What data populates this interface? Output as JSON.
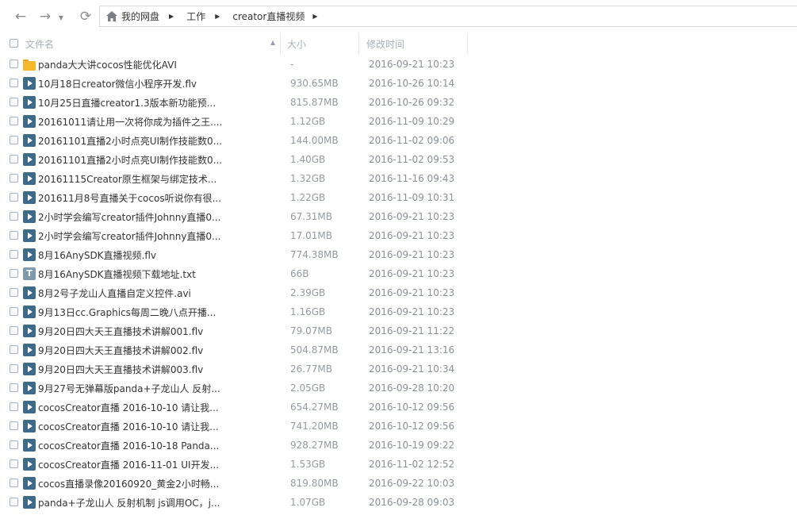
{
  "nav": {
    "back_glyph": "←",
    "forward_glyph": "→",
    "menu_glyph": "▼",
    "refresh_glyph": "⟳",
    "breadcrumbs": [
      "我的网盘",
      "工作",
      "creator直播视频"
    ],
    "sep_glyph": "▶",
    "caret_glyph": "▶"
  },
  "columns": {
    "name": "文件名",
    "size": "大小",
    "modified": "修改时间",
    "sort_glyph": "▲"
  },
  "files": [
    {
      "icon": "folder",
      "name": "panda大大讲cocos性能优化AVI",
      "size": "-",
      "date": "2016-09-21 10:23"
    },
    {
      "icon": "video",
      "name": "10月18日creator微信小程序开发.flv",
      "size": "930.65MB",
      "date": "2016-10-26 10:14"
    },
    {
      "icon": "video",
      "name": "10月25日直播creator1.3版本新功能预...",
      "size": "815.87MB",
      "date": "2016-10-26 09:32"
    },
    {
      "icon": "video",
      "name": "20161011请让用一次将你成为插件之王....",
      "size": "1.12GB",
      "date": "2016-11-09 10:29"
    },
    {
      "icon": "video",
      "name": "20161101直播2小时点亮UI制作技能数0...",
      "size": "144.00MB",
      "date": "2016-11-02 09:06"
    },
    {
      "icon": "video",
      "name": "20161101直播2小时点亮UI制作技能数0...",
      "size": "1.40GB",
      "date": "2016-11-02 09:53"
    },
    {
      "icon": "video",
      "name": "20161115Creator原生框架与绑定技术...",
      "size": "1.32GB",
      "date": "2016-11-16 09:43"
    },
    {
      "icon": "video",
      "name": "201611月8号直播关于cocos听说你有很...",
      "size": "1.22GB",
      "date": "2016-11-09 10:31"
    },
    {
      "icon": "video",
      "name": "2小时学会编写creator插件Johnny直播0...",
      "size": "67.31MB",
      "date": "2016-09-21 10:23"
    },
    {
      "icon": "video",
      "name": "2小时学会编写creator插件Johnny直播0...",
      "size": "17.01MB",
      "date": "2016-09-21 10:23"
    },
    {
      "icon": "video",
      "name": "8月16AnySDK直播视频.flv",
      "size": "774.38MB",
      "date": "2016-09-21 10:23"
    },
    {
      "icon": "text",
      "name": "8月16AnySDK直播视频下载地址.txt",
      "size": "66B",
      "date": "2016-09-21 10:23"
    },
    {
      "icon": "video",
      "name": "8月2号子龙山人直播自定义控件.avi",
      "size": "2.39GB",
      "date": "2016-09-21 10:23"
    },
    {
      "icon": "video",
      "name": "9月13日cc.Graphics每周二晚八点开播...",
      "size": "1.16GB",
      "date": "2016-09-21 10:23"
    },
    {
      "icon": "video",
      "name": "9月20日四大天王直播技术讲解001.flv",
      "size": "79.07MB",
      "date": "2016-09-21 11:22"
    },
    {
      "icon": "video",
      "name": "9月20日四大天王直播技术讲解002.flv",
      "size": "504.87MB",
      "date": "2016-09-21 13:16"
    },
    {
      "icon": "video",
      "name": "9月20日四大天王直播技术讲解003.flv",
      "size": "26.77MB",
      "date": "2016-09-21 10:34"
    },
    {
      "icon": "video",
      "name": "9月27号无弹幕版panda+子龙山人 反射...",
      "size": "2.05GB",
      "date": "2016-09-28 10:20"
    },
    {
      "icon": "video",
      "name": "cocosCreator直播 2016-10-10 请让我...",
      "size": "654.27MB",
      "date": "2016-10-12 09:56"
    },
    {
      "icon": "video",
      "name": "cocosCreator直播 2016-10-10 请让我...",
      "size": "741.20MB",
      "date": "2016-10-12 09:56"
    },
    {
      "icon": "video",
      "name": "cocosCreator直播 2016-10-18 Panda...",
      "size": "928.27MB",
      "date": "2016-10-19 09:22"
    },
    {
      "icon": "video",
      "name": "cocosCreator直播 2016-11-01 UI开发...",
      "size": "1.53GB",
      "date": "2016-11-02 12:52"
    },
    {
      "icon": "video",
      "name": "cocos直播录像20160920_黄金2小时畅...",
      "size": "819.80MB",
      "date": "2016-09-22 10:03"
    },
    {
      "icon": "video",
      "name": "panda+子龙山人 反射机制 js调用OC，j...",
      "size": "1.07GB",
      "date": "2016-09-28 09:03"
    }
  ]
}
